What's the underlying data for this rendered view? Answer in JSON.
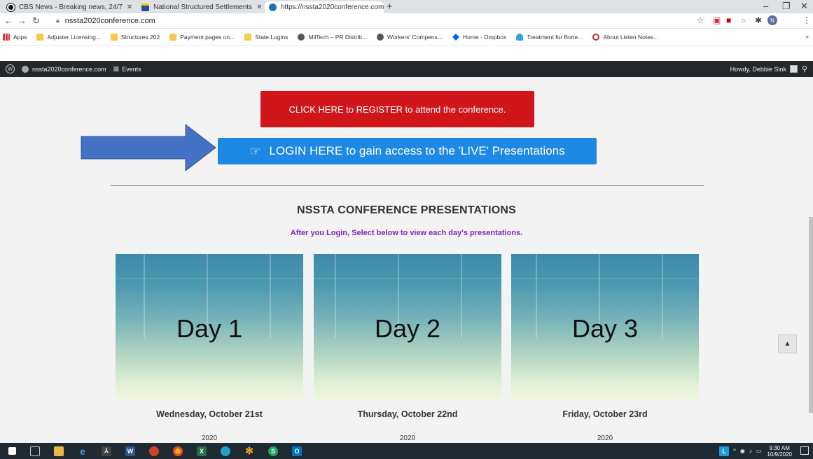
{
  "browser": {
    "tabs": [
      {
        "label": "CBS News - Breaking news, 24/7",
        "favicon_color": "#111111"
      },
      {
        "label": "National Structured Settlements",
        "favicon_color": "#1f4e9e"
      },
      {
        "label": "https://nssta2020conference.com",
        "favicon_color": "#2271b1"
      }
    ],
    "new_tab": "+",
    "url": "nssta2020conference.com",
    "bookmarks": [
      {
        "label": "Apps",
        "icon": "apps-grid-icon"
      },
      {
        "label": "Adjuster Licensing...",
        "icon": "folder-icon"
      },
      {
        "label": "Structures 202",
        "icon": "folder-icon"
      },
      {
        "label": "Payment pages on...",
        "icon": "folder-icon"
      },
      {
        "label": "State Logins",
        "icon": "folder-icon"
      },
      {
        "label": "MilTech – PR Distrib...",
        "icon": "globe-icon"
      },
      {
        "label": "Workers' Compens...",
        "icon": "globe-icon"
      },
      {
        "label": "Home - Dropbox",
        "icon": "dropbox-icon"
      },
      {
        "label": "Treatment for Bone...",
        "icon": "heart-icon"
      },
      {
        "label": "About Listen Notes...",
        "icon": "search-icon"
      }
    ],
    "bookmarks_more": "»"
  },
  "wp_admin": {
    "site_name": "nssta2020conference.com",
    "events_label": "Events",
    "greeting": "Howdy, Debbie Sink"
  },
  "page": {
    "register_button": "CLICK HERE to REGISTER to attend the conference.",
    "login_button": "LOGIN HERE to gain access to the 'LIVE' Presentations",
    "section_title": "NSSTA CONFERENCE PRESENTATIONS",
    "section_subtitle": "After you Login, Select below to view each day's presentations.",
    "days": [
      {
        "label": "Day 1",
        "date": "Wednesday, October 21st",
        "year": "2020"
      },
      {
        "label": "Day 2",
        "date": "Thursday, October 22nd",
        "year": "2020"
      },
      {
        "label": "Day 3",
        "date": "Friday, October 23rd",
        "year": "2020"
      }
    ],
    "colors": {
      "register": "#d0161a",
      "login": "#1e88e5",
      "subtitle": "#8224b9",
      "arrow": "#4472c4"
    }
  },
  "taskbar": {
    "time": "9:30 AM",
    "date": "10/9/2020"
  }
}
